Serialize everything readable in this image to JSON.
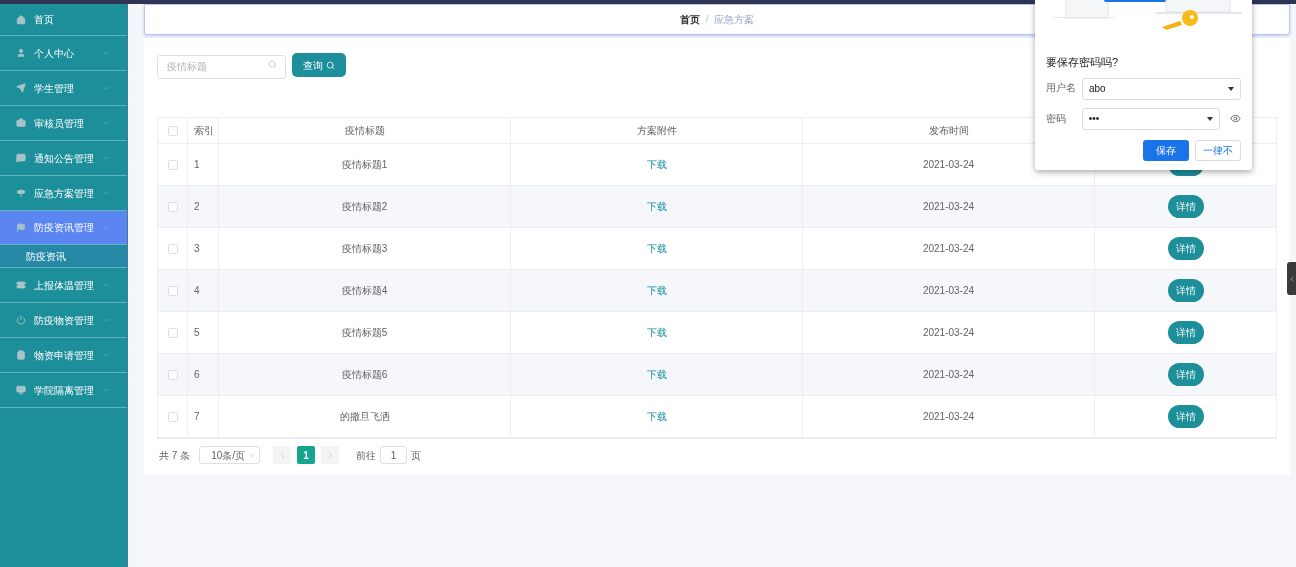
{
  "sidebar": {
    "items": [
      {
        "label": "首页",
        "selected": false
      },
      {
        "label": "个人中心",
        "selected": false,
        "expanded": false
      },
      {
        "label": "学生管理",
        "selected": false,
        "expanded": false
      },
      {
        "label": "审核员管理",
        "selected": false,
        "expanded": false
      },
      {
        "label": "通知公告管理",
        "selected": false,
        "expanded": false
      },
      {
        "label": "应急方案管理",
        "selected": false,
        "expanded": false
      },
      {
        "label": "防疫资讯管理",
        "selected": true,
        "expanded": true,
        "children": [
          {
            "label": "防疫资讯",
            "selected": false
          }
        ]
      },
      {
        "label": "上报体温管理",
        "selected": false,
        "expanded": false
      },
      {
        "label": "防疫物资管理",
        "selected": false,
        "expanded": false
      },
      {
        "label": "物资申请管理",
        "selected": false,
        "expanded": false
      },
      {
        "label": "学院隔离管理",
        "selected": false,
        "expanded": false
      }
    ]
  },
  "breadcrumb": {
    "separator": "/",
    "items": [
      {
        "label": "首页",
        "current": false
      },
      {
        "label": "应急方案",
        "current": true
      }
    ]
  },
  "search": {
    "placeholder": "疫情标题",
    "button": "查询"
  },
  "table": {
    "columns": [
      "索引",
      "疫情标题",
      "方案附件",
      "发布时间"
    ],
    "header_checked": false,
    "rows": [
      {
        "checked": false,
        "index": "1",
        "title": "疫情标题1",
        "attachment": "下载",
        "date": "2021-03-24"
      },
      {
        "checked": false,
        "index": "2",
        "title": "疫情标题2",
        "attachment": "下载",
        "date": "2021-03-24",
        "action": "详情"
      },
      {
        "checked": false,
        "index": "3",
        "title": "疫情标题3",
        "attachment": "下载",
        "date": "2021-03-24",
        "action": "详情"
      },
      {
        "checked": false,
        "index": "4",
        "title": "疫情标题4",
        "attachment": "下载",
        "date": "2021-03-24",
        "action": "详情"
      },
      {
        "checked": false,
        "index": "5",
        "title": "疫情标题5",
        "attachment": "下载",
        "date": "2021-03-24",
        "action": "详情"
      },
      {
        "checked": false,
        "index": "6",
        "title": "疫情标题6",
        "attachment": "下载",
        "date": "2021-03-24",
        "action": "详情"
      },
      {
        "checked": false,
        "index": "7",
        "title": "的撒旦飞洒",
        "attachment": "下载",
        "date": "2021-03-24",
        "action": "详情"
      }
    ]
  },
  "pagination": {
    "total": "共 7 条",
    "page_size": "10条/页",
    "pages": [
      {
        "label": "1",
        "selected": true
      }
    ],
    "goto_label": "前往",
    "goto_value": "1",
    "goto_suffix": "页"
  },
  "password_dialog": {
    "title": "要保存密码吗?",
    "username_label": "用户名",
    "username": "abo",
    "password_label": "密码",
    "password": "•••",
    "save": "保存",
    "never": "一律不"
  }
}
